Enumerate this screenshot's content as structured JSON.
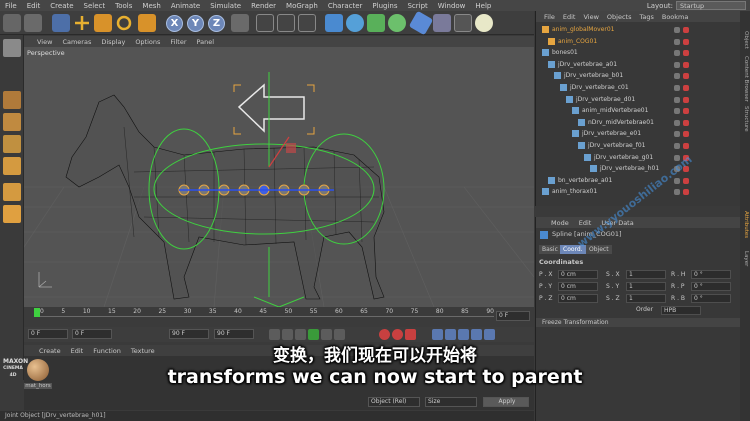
{
  "menubar": {
    "items": [
      "File",
      "Edit",
      "Create",
      "Select",
      "Tools",
      "Mesh",
      "Animate",
      "Simulate",
      "Render",
      "MoGraph",
      "Character",
      "Plugins",
      "Script",
      "Window",
      "Help"
    ],
    "layout_label": "Layout:",
    "layout_value": "Startup"
  },
  "toolbar": {
    "axis_x": "X",
    "axis_y": "Y",
    "axis_z": "Z"
  },
  "viewport": {
    "menu": [
      "View",
      "Cameras",
      "Display",
      "Options",
      "Filter",
      "Panel"
    ],
    "label": "Perspective"
  },
  "timeline": {
    "ticks": [
      "0",
      "5",
      "10",
      "15",
      "20",
      "25",
      "30",
      "35",
      "40",
      "45",
      "50",
      "55",
      "60",
      "65",
      "70",
      "75",
      "80",
      "85",
      "90"
    ],
    "current_frame": "0 F",
    "start_field": "0 F",
    "min_field": "0 F",
    "end_field": "90 F",
    "max_field": "90 F"
  },
  "material_manager": {
    "menu": [
      "Create",
      "Edit",
      "Function",
      "Texture"
    ],
    "material_name": "mat_hors"
  },
  "status_bar": "Joint Object [JDrv_vertebrae_h01]",
  "object_manager": {
    "menu": [
      "File",
      "Edit",
      "View",
      "Objects",
      "Tags",
      "Bookma"
    ],
    "rows": [
      {
        "name": "anim_globalMover01",
        "indent": 0,
        "highlight": true
      },
      {
        "name": "anim_COG01",
        "indent": 1,
        "highlight": true
      },
      {
        "name": "bones01",
        "indent": 0,
        "highlight": false
      },
      {
        "name": "jDrv_vertebrae_a01",
        "indent": 1,
        "highlight": false
      },
      {
        "name": "jDrv_vertebrae_b01",
        "indent": 2,
        "highlight": false
      },
      {
        "name": "jDrv_vertebrae_c01",
        "indent": 3,
        "highlight": false
      },
      {
        "name": "jDrv_vertebrae_d01",
        "indent": 4,
        "highlight": false
      },
      {
        "name": "anim_midVertebrae01",
        "indent": 5,
        "highlight": false
      },
      {
        "name": "nDrv_midVertebrae01",
        "indent": 6,
        "highlight": false
      },
      {
        "name": "jDrv_vertebrae_e01",
        "indent": 5,
        "highlight": false
      },
      {
        "name": "jDrv_vertebrae_f01",
        "indent": 6,
        "highlight": false
      },
      {
        "name": "jDrv_vertebrae_g01",
        "indent": 7,
        "highlight": false
      },
      {
        "name": "jDrv_vertebrae_h01",
        "indent": 8,
        "highlight": false
      },
      {
        "name": "bn_vertebrae_a01",
        "indent": 1,
        "highlight": false
      },
      {
        "name": "anim_thorax01",
        "indent": 0,
        "highlight": false
      }
    ]
  },
  "attribute_manager": {
    "menu": [
      "Mode",
      "Edit",
      "User Data"
    ],
    "object_title": "Spline [anim_COG01]",
    "tabs": [
      "Basic",
      "Coord.",
      "Object"
    ],
    "active_tab": "Coord.",
    "section": "Coordinates",
    "rows": [
      {
        "p": "P . X",
        "pv": "0 cm",
        "s": "S . X",
        "sv": "1",
        "r": "R . H",
        "rv": "0 °"
      },
      {
        "p": "P . Y",
        "pv": "0 cm",
        "s": "S . Y",
        "sv": "1",
        "r": "R . P",
        "rv": "0 °"
      },
      {
        "p": "P . Z",
        "pv": "0 cm",
        "s": "S . Z",
        "sv": "1",
        "r": "R . B",
        "rv": "0 °"
      }
    ],
    "order_label": "Order",
    "order_value": "HPB",
    "freeze_label": "Freeze Transformation"
  },
  "bottom_fields": {
    "object_rel": "Object (Rel)",
    "size": "Size",
    "apply": "Apply"
  },
  "side_tabs": [
    "Object",
    "Content Browser",
    "Structure",
    "Attributes",
    "Layer"
  ],
  "subtitles": {
    "chinese": "变换，我们现在可以开始将",
    "english": "transforms we can now start to parent"
  },
  "watermark": "www.yyouoshiliao.com",
  "brand": {
    "line1": "MAXON",
    "line2": "CINEMA 4D"
  },
  "colors": {
    "accent_blue": "#6d87b8",
    "selected_orange": "#e6a540",
    "spline_green": "#3fd040"
  }
}
